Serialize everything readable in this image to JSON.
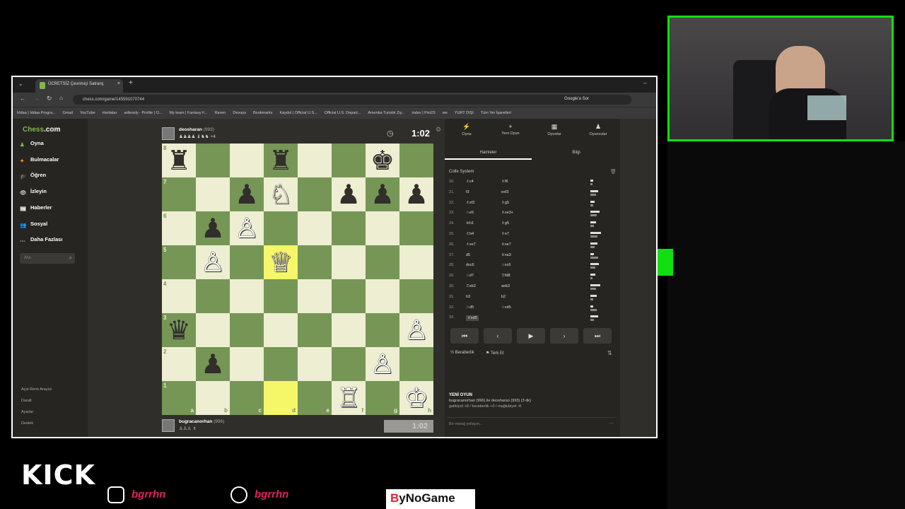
{
  "browser": {
    "tab_title": "ÜCRETSİZ Çevrimiçi Satranç",
    "url": "chess.com/game/145591070744",
    "google_btn": "Google'a Sor",
    "bookmarks": [
      "İddaa | İddaa Progra...",
      "Gmail",
      "YouTube",
      "Haritalar",
      "artlessly - Profile | O...",
      "My team | Fantasy F...",
      "Raven",
      "Devops",
      "Bookmarks",
      "Kaydol | Official U.S...",
      "Official U.S. Depart...",
      "Amerika Turistik Ziy...",
      "index | Pixi2S",
      "we",
      "YURT DIŞI",
      "Tüm Yer İşaretleri"
    ]
  },
  "sidebar": {
    "logo_a": "Chess",
    "logo_b": ".com",
    "items": [
      "Oyna",
      "Bulmacalar",
      "Öğren",
      "İzleyin",
      "Haberler",
      "Sosyal",
      "Daha Fazlası"
    ],
    "search_placeholder": "Ara",
    "bottom": [
      "Açık Renk Arayüz",
      "Daralt",
      "Ayarlar",
      "Destek"
    ]
  },
  "top_player": {
    "name": "deosharan",
    "rating": "(993)",
    "clock": "1:02",
    "material": "+4"
  },
  "bottom_player": {
    "name": "bugracanorhan",
    "rating": "(996)",
    "clock": "1:02"
  },
  "board": {
    "ranks": [
      "8",
      "7",
      "6",
      "5",
      "4",
      "3",
      "2",
      "1"
    ],
    "files": [
      "a",
      "b",
      "c",
      "d",
      "e",
      "f",
      "g",
      "h"
    ],
    "pieces": [
      {
        "sq": "a8",
        "p": "♜",
        "c": "b"
      },
      {
        "sq": "d8",
        "p": "♜",
        "c": "b"
      },
      {
        "sq": "g8",
        "p": "♚",
        "c": "b"
      },
      {
        "sq": "c7",
        "p": "♟",
        "c": "b"
      },
      {
        "sq": "d7",
        "p": "♘",
        "c": "w"
      },
      {
        "sq": "f7",
        "p": "♟",
        "c": "b"
      },
      {
        "sq": "g7",
        "p": "♟",
        "c": "b"
      },
      {
        "sq": "h7",
        "p": "♟",
        "c": "b"
      },
      {
        "sq": "b6",
        "p": "♟",
        "c": "b"
      },
      {
        "sq": "c6",
        "p": "♙",
        "c": "w"
      },
      {
        "sq": "b5",
        "p": "♙",
        "c": "w"
      },
      {
        "sq": "d5",
        "p": "♕",
        "c": "w"
      },
      {
        "sq": "a3",
        "p": "♛",
        "c": "b"
      },
      {
        "sq": "h3",
        "p": "♙",
        "c": "w"
      },
      {
        "sq": "b2",
        "p": "♟",
        "c": "b"
      },
      {
        "sq": "g2",
        "p": "♙",
        "c": "w"
      },
      {
        "sq": "f1",
        "p": "♖",
        "c": "w"
      },
      {
        "sq": "h1",
        "p": "♔",
        "c": "w"
      }
    ],
    "highlights": [
      "d5",
      "d1"
    ]
  },
  "panel": {
    "tabs": [
      {
        "icon": "⚡",
        "label": "Oyna"
      },
      {
        "icon": "+",
        "label": "Yeni Oyun"
      },
      {
        "icon": "▦",
        "label": "Oyunlar"
      },
      {
        "icon": "♟",
        "label": "Oyuncular"
      }
    ],
    "subtabs": [
      "Hamleler",
      "Bilgi"
    ],
    "opening": "Colle System",
    "moves": [
      {
        "n": "20.",
        "w": "♗c4",
        "b": "♗f6"
      },
      {
        "n": "21.",
        "w": "f3",
        "b": "exf3"
      },
      {
        "n": "22.",
        "w": "♗xf3",
        "b": "♗g5"
      },
      {
        "n": "23.",
        "w": "♘e5",
        "b": "♗xe3+"
      },
      {
        "n": "24.",
        "w": "♔h1",
        "b": "♗g5"
      },
      {
        "n": "25.",
        "w": "♗b4",
        "b": "♗e7"
      },
      {
        "n": "26.",
        "w": "♗xe7",
        "b": "♕xe7"
      },
      {
        "n": "27.",
        "w": "d5",
        "b": "♕xa3"
      },
      {
        "n": "28.",
        "w": "dxc6",
        "b": "♘xc6"
      },
      {
        "n": "29.",
        "w": "♘d7",
        "b": "♖fd8"
      },
      {
        "n": "30.",
        "w": "♖xb3",
        "b": "axb3"
      },
      {
        "n": "31.",
        "w": "h3",
        "b": "b2"
      },
      {
        "n": "32.",
        "w": "♘d5",
        "b": "♘xd5"
      },
      {
        "n": "33.",
        "w": "♕xd5",
        "b": ""
      }
    ],
    "draw": "Beraberlik",
    "resign": "Terk Et",
    "new_game_title": "YENİ OYUN",
    "new_game_line1": "bugracanorhan (996) ile deosharan (993) (3 dk)",
    "new_game_line2": "galibiyet +8 / beraberlik +0 / mağlubiyet -8",
    "chat_placeholder": "Bir mesaj yollayın..."
  },
  "overlay": {
    "kick": "KICK",
    "instagram": "bgrrhn",
    "twitter": "bgrrhn",
    "sponsor": "ByNoGame"
  }
}
